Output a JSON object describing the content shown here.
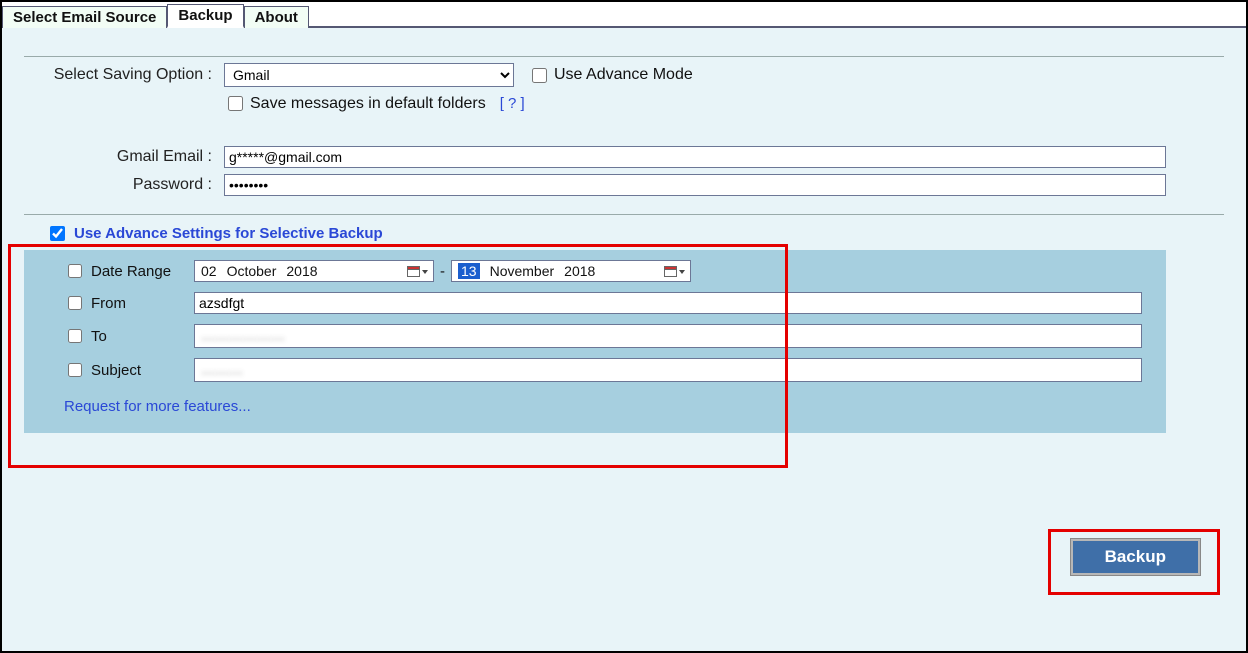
{
  "tabs": {
    "select_source": "Select Email Source",
    "backup": "Backup",
    "about": "About"
  },
  "saving": {
    "label": "Select Saving Option :",
    "selected": "Gmail",
    "advance_mode_label": "Use Advance Mode",
    "default_folders_label": "Save messages in default folders",
    "help_link": "[  ?  ]"
  },
  "credentials": {
    "email_label": "Gmail Email :",
    "email_value": "g*****@gmail.com",
    "password_label": "Password :",
    "password_value": "••••••••"
  },
  "advance": {
    "header": "Use Advance Settings for Selective Backup",
    "date_range_label": "Date Range",
    "date_from": {
      "day": "02",
      "month": "October",
      "year": "2018"
    },
    "date_to": {
      "day": "13",
      "month": "November",
      "year": "2018"
    },
    "from_label": "From",
    "from_value": "azsdfgt",
    "to_label": "To",
    "to_value": "………………",
    "subject_label": "Subject",
    "subject_value": "………",
    "request_link": "Request for more features..."
  },
  "backup_button": "Backup",
  "dash": "-"
}
